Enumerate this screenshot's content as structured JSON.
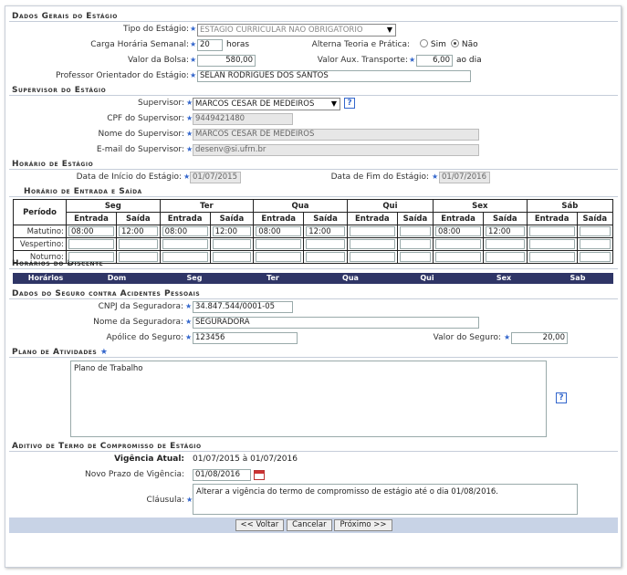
{
  "sections": {
    "dados_gerais": "Dados Gerais do Estágio",
    "supervisor": "Supervisor do Estágio",
    "horario_estagio": "Horário de Estágio",
    "horario_entrada_saida": "Horário de Entrada e Saída",
    "horarios_discente": "Horários do Discente",
    "seguro": "Dados do Seguro contra Acidentes Pessoais",
    "plano": "Plano de Atividades",
    "aditivo": "Aditivo de Termo de Compromisso de Estágio"
  },
  "gerais": {
    "tipo_label": "Tipo do Estágio:",
    "tipo_value": "ESTAGIO CURRICULAR NAO OBRIGATORIO",
    "carga_label": "Carga Horária Semanal:",
    "carga_value": "20",
    "carga_unit": "horas",
    "alterna_label": "Alterna Teoria e Prática:",
    "sim": "Sim",
    "nao": "Não",
    "alterna_selected": "Não",
    "bolsa_label": "Valor da Bolsa:",
    "bolsa_value": "580,00",
    "aux_label": "Valor Aux. Transporte:",
    "aux_value": "6,00",
    "aux_unit": "ao dia",
    "professor_label": "Professor Orientador do Estágio:",
    "professor_value": "SELAN RODRIGUES DOS SANTOS"
  },
  "supervisor": {
    "sup_label": "Supervisor:",
    "sup_value": "MARCOS CESAR DE MEDEIROS",
    "cpf_label": "CPF do Supervisor:",
    "cpf_value": "9449421480",
    "nome_label": "Nome do Supervisor:",
    "nome_value": "MARCOS CESAR DE MEDEIROS",
    "email_label": "E-mail do Supervisor:",
    "email_value": "desenv@si.ufrn.br"
  },
  "horario": {
    "inicio_label": "Data de Início do Estágio:",
    "inicio_value": "01/07/2015",
    "fim_label": "Data de Fim do Estágio:",
    "fim_value": "01/07/2016"
  },
  "schedule": {
    "periodo": "Período",
    "entrada": "Entrada",
    "saida": "Saída",
    "days": [
      "Seg",
      "Ter",
      "Qua",
      "Qui",
      "Sex",
      "Sáb"
    ],
    "rows": [
      {
        "label": "Matutino:",
        "values": [
          "08:00",
          "12:00",
          "08:00",
          "12:00",
          "08:00",
          "12:00",
          "",
          "",
          "08:00",
          "12:00",
          "",
          ""
        ]
      },
      {
        "label": "Vespertino:",
        "values": [
          "",
          "",
          "",
          "",
          "",
          "",
          "",
          "",
          "",
          "",
          "",
          ""
        ]
      },
      {
        "label": "Noturno:",
        "values": [
          "",
          "",
          "",
          "",
          "",
          "",
          "",
          "",
          "",
          "",
          "",
          ""
        ]
      }
    ]
  },
  "discente": {
    "cols": [
      "Horários",
      "Dom",
      "Seg",
      "Ter",
      "Qua",
      "Qui",
      "Sex",
      "Sab"
    ]
  },
  "seguro": {
    "cnpj_label": "CNPJ da Seguradora:",
    "cnpj_value": "34.847.544/0001-05",
    "nome_label": "Nome da Seguradora:",
    "nome_value": "SEGURADORA",
    "apolice_label": "Apólice do Seguro:",
    "apolice_value": "123456",
    "valor_label": "Valor do Seguro:",
    "valor_value": "20,00"
  },
  "plano": {
    "text": "Plano de Trabalho"
  },
  "aditivo": {
    "vigencia_label": "Vigência Atual:",
    "vigencia_value": "01/07/2015 à 01/07/2016",
    "prazo_label": "Novo Prazo de Vigência:",
    "prazo_value": "01/08/2016",
    "clausula_label": "Cláusula:",
    "clausula_value": "Alterar a vigência do termo de compromisso de estágio até o dia 01/08/2016."
  },
  "buttons": {
    "voltar": "<< Voltar",
    "cancelar": "Cancelar",
    "proximo": "Próximo >>"
  },
  "icons": {
    "required": "star-icon",
    "help": "help-icon",
    "calendar": "calendar-icon"
  }
}
